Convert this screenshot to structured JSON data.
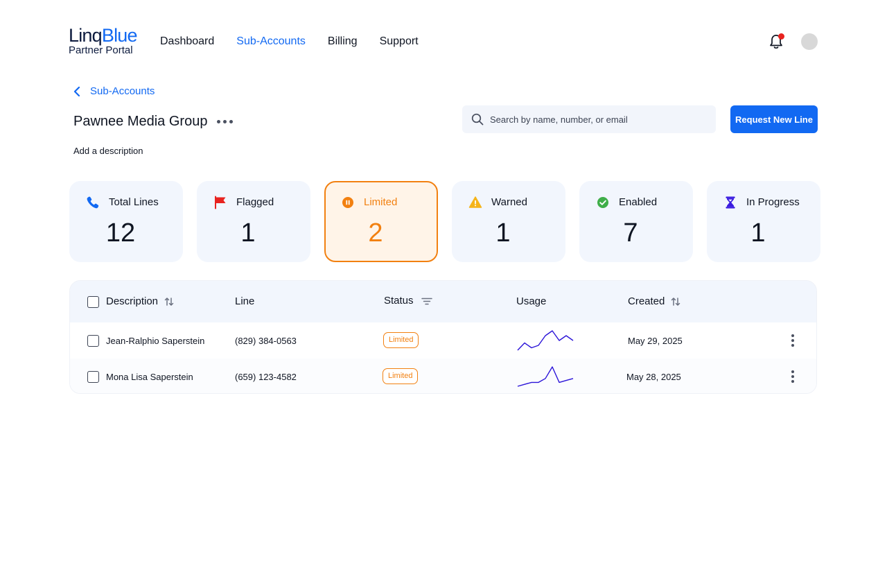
{
  "header": {
    "logo_part1": "Linq",
    "logo_part2": "Blue",
    "logo_sub": "Partner Portal",
    "nav": [
      {
        "label": "Dashboard"
      },
      {
        "label": "Sub-Accounts",
        "active": true
      },
      {
        "label": "Billing"
      },
      {
        "label": "Support"
      }
    ],
    "icons": {
      "notifications": "bell-icon",
      "avatar": "avatar"
    }
  },
  "breadcrumb": {
    "back_label": "Sub-Accounts"
  },
  "account": {
    "title": "Pawnee Media Group",
    "description_link": "Add a description"
  },
  "search": {
    "placeholder": "Search by name, number, or email",
    "value": ""
  },
  "actions": {
    "request_new_line": "Request New Line"
  },
  "stats": [
    {
      "label": "Total Lines",
      "value": "12",
      "icon": "phone-icon",
      "color": "#1269f2"
    },
    {
      "label": "Flagged",
      "value": "1",
      "icon": "flag-icon",
      "color": "#e8231f"
    },
    {
      "label": "Limited",
      "value": "2",
      "icon": "pause-icon",
      "color": "#f28010",
      "selected": true
    },
    {
      "label": "Warned",
      "value": "1",
      "icon": "warning-icon",
      "color": "#f5b41a"
    },
    {
      "label": "Enabled",
      "value": "7",
      "icon": "check-circle-icon",
      "color": "#3fae49"
    },
    {
      "label": "In Progress",
      "value": "1",
      "icon": "hourglass-icon",
      "color": "#3a1be0"
    }
  ],
  "table": {
    "columns": [
      "Description",
      "Line",
      "Status",
      "Usage",
      "Created"
    ],
    "rows": [
      {
        "description": "Jean-Ralphio Saperstein",
        "line": "(829) 384-0563",
        "status": "Limited",
        "usage": [
          0,
          3,
          1,
          2,
          6,
          8,
          4,
          6,
          4
        ],
        "created": "May 29, 2025"
      },
      {
        "description": "Mona Lisa Saperstein",
        "line": "(659) 123-4582",
        "status": "Limited",
        "usage": [
          0,
          1,
          2,
          2,
          4,
          10,
          2,
          3,
          4
        ],
        "created": "May 28, 2025"
      }
    ]
  },
  "colors": {
    "accent": "#1269f2",
    "limited": "#f28010",
    "sparkline": "#2a13d8"
  }
}
